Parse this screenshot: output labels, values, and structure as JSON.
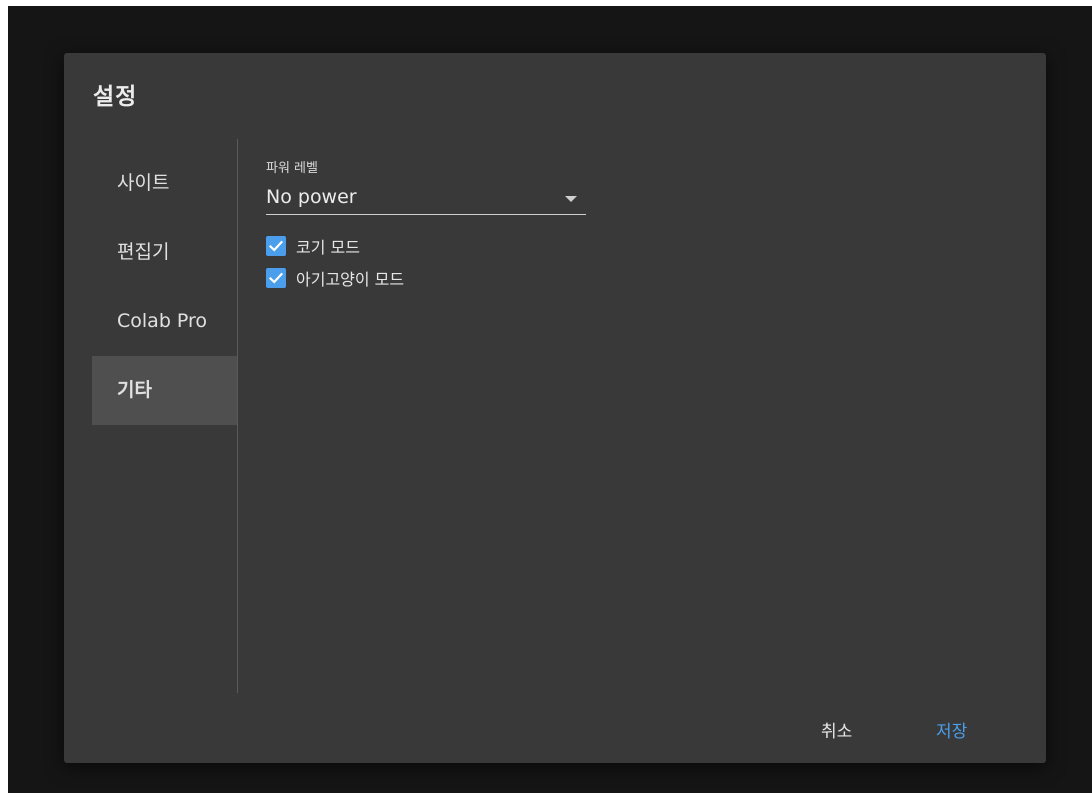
{
  "dialog": {
    "title": "설정"
  },
  "sidebar": {
    "items": [
      {
        "label": "사이트",
        "active": false
      },
      {
        "label": "편집기",
        "active": false
      },
      {
        "label": "Colab Pro",
        "active": false
      },
      {
        "label": "기타",
        "active": true
      }
    ]
  },
  "content": {
    "power_level": {
      "label": "파워 레벨",
      "value": "No power"
    },
    "checkboxes": [
      {
        "label": "코기 모드",
        "checked": true
      },
      {
        "label": "아기고양이 모드",
        "checked": true
      }
    ]
  },
  "footer": {
    "cancel_label": "취소",
    "save_label": "저장"
  },
  "colors": {
    "accent": "#4a9eec",
    "dialog_bg": "#393939",
    "active_item_bg": "#4f4f4f",
    "backdrop": "#151515"
  },
  "icons": {
    "select_arrow": "caret-down-icon",
    "checkbox": "checkmark-icon"
  }
}
